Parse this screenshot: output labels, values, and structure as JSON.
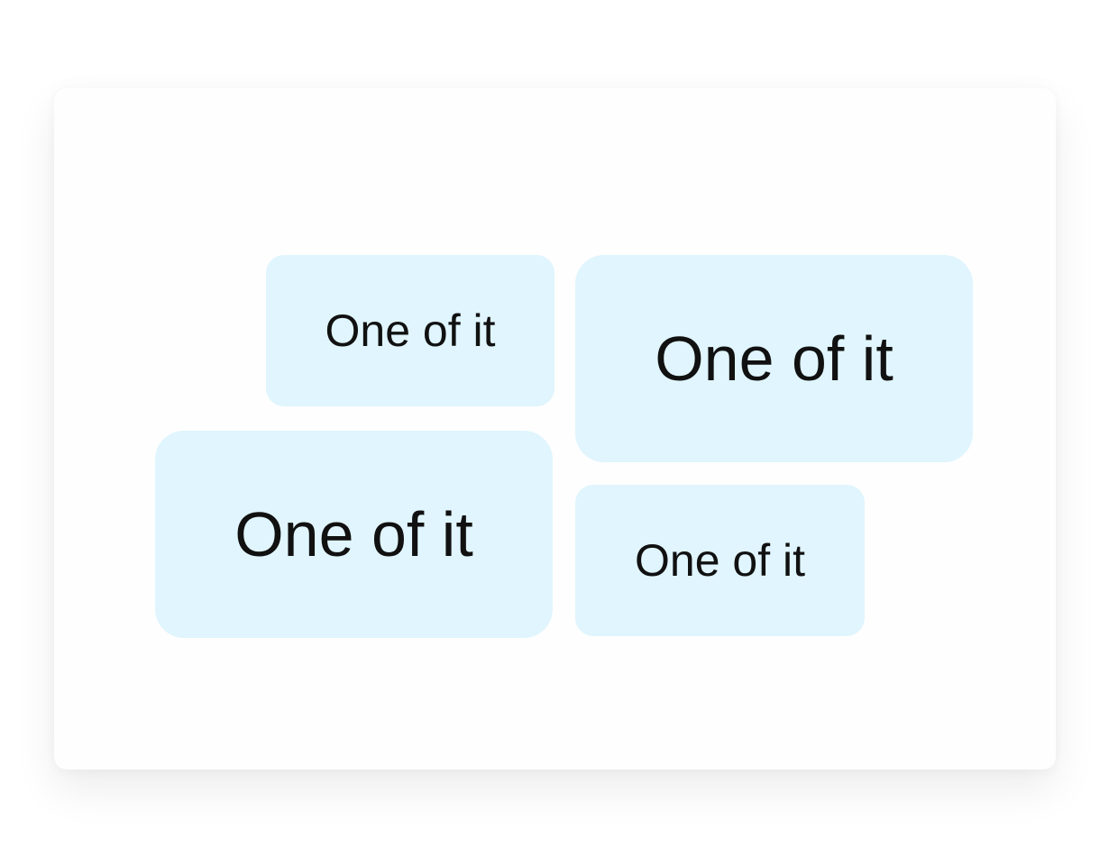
{
  "tiles": [
    {
      "id": "tile-1",
      "label": "One of it"
    },
    {
      "id": "tile-2",
      "label": "One of it"
    },
    {
      "id": "tile-3",
      "label": "One of it"
    },
    {
      "id": "tile-4",
      "label": "One of it"
    }
  ],
  "colors": {
    "page_background": "#ffffff",
    "card_background": "#fefefe",
    "tile_background": "#e0f5fd",
    "tile_text": "#111111"
  }
}
